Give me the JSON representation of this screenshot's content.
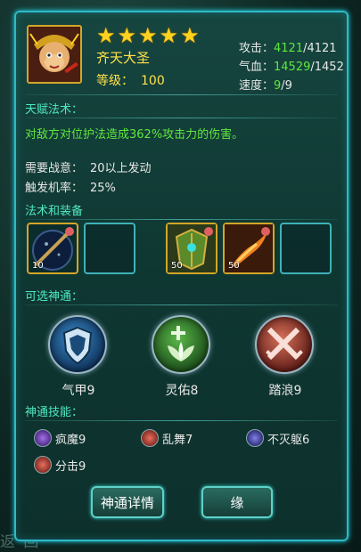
{
  "hero": {
    "name": "齐天大圣",
    "level_label": "等级：",
    "level_value": "100",
    "stars": 5
  },
  "stats": {
    "attack_label": "攻击：",
    "attack_current": "4121",
    "attack_max": "/4121",
    "hp_label": "气血：",
    "hp_current": "14529",
    "hp_max": "/1452",
    "speed_label": "速度：",
    "speed_current": "9",
    "speed_max": "/9"
  },
  "talent": {
    "title": "天赋法术：",
    "description": "对敌方对位护法造成362%攻击力的伤害。",
    "req_label": "需要战意：",
    "req_value": "20以上发动",
    "chance_label": "触发机率：",
    "chance_value": "25%"
  },
  "equipment": {
    "title": "法术和装备",
    "slots": [
      {
        "count": "10",
        "filled": true,
        "icon": "staff-orb-icon"
      },
      {
        "count": "",
        "filled": false,
        "icon": "empty-slot"
      },
      {
        "count": "50",
        "filled": true,
        "icon": "armor-icon"
      },
      {
        "count": "50",
        "filled": true,
        "icon": "flame-staff-icon"
      },
      {
        "count": "",
        "filled": false,
        "icon": "empty-slot"
      }
    ]
  },
  "divine": {
    "title": "可选神通：",
    "options": [
      {
        "label": "气甲9",
        "icon": "shield-icon",
        "color": "#1a4a78"
      },
      {
        "label": "灵佑8",
        "icon": "lotus-heal-icon",
        "color": "#2a6a2a"
      },
      {
        "label": "踏浪9",
        "icon": "crossed-swords-icon",
        "color": "#7a2a24"
      }
    ]
  },
  "skills": {
    "title": "神通技能：",
    "items": [
      {
        "label": "疯魔9",
        "icon": "frenzy-icon",
        "color": "#6a3ab8"
      },
      {
        "label": "乱舞7",
        "icon": "sword-dance-icon",
        "color": "#b83a30"
      },
      {
        "label": "不灭躯6",
        "icon": "immortal-body-icon",
        "color": "#3a3a9a"
      },
      {
        "label": "分击9",
        "icon": "split-strike-icon",
        "color": "#b83a30"
      }
    ]
  },
  "buttons": {
    "detail": "神通详情",
    "fate": "缘"
  },
  "footer": {
    "back": "返 回"
  }
}
